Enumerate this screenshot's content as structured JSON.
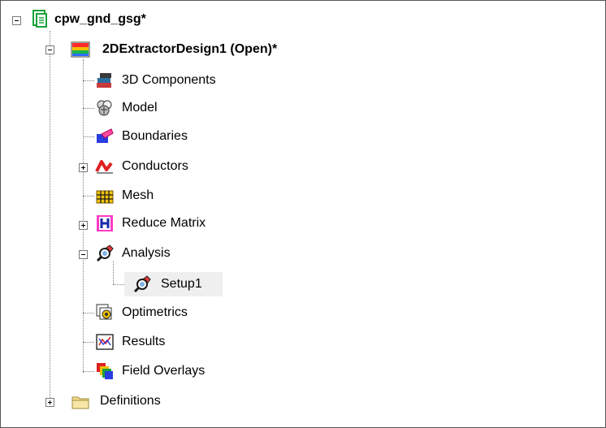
{
  "tree": {
    "project": {
      "label": "cpw_gnd_gsg*"
    },
    "design": {
      "label": "2DExtractorDesign1 (Open)*"
    },
    "items": [
      {
        "label": "3D Components"
      },
      {
        "label": "Model"
      },
      {
        "label": "Boundaries"
      },
      {
        "label": "Conductors"
      },
      {
        "label": "Mesh"
      },
      {
        "label": "Reduce Matrix"
      },
      {
        "label": "Analysis"
      },
      {
        "label": "Setup1"
      },
      {
        "label": "Optimetrics"
      },
      {
        "label": "Results"
      },
      {
        "label": "Field Overlays"
      }
    ],
    "definitions": {
      "label": "Definitions"
    }
  }
}
